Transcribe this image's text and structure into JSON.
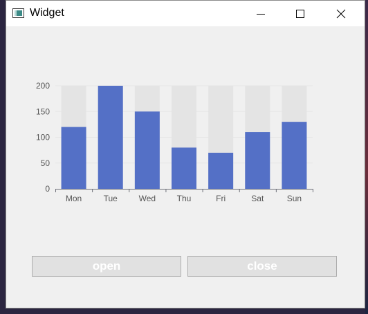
{
  "window": {
    "title": "Widget"
  },
  "buttons": {
    "open_label": "open",
    "close_label": "close"
  },
  "icons": {
    "app": "app-window-icon",
    "minimize": "minimize-icon",
    "maximize": "maximize-icon",
    "close": "close-icon"
  },
  "colors": {
    "bar": "#5470c6",
    "bar_background": "#e4e4e4",
    "window_bg": "#f0f0f0"
  },
  "chart_data": {
    "type": "bar",
    "categories": [
      "Mon",
      "Tue",
      "Wed",
      "Thu",
      "Fri",
      "Sat",
      "Sun"
    ],
    "values": [
      120,
      200,
      150,
      80,
      70,
      110,
      130
    ],
    "ylim": [
      0,
      200
    ],
    "yticks": [
      0,
      50,
      100,
      150,
      200
    ],
    "show_background": true,
    "grid": true
  }
}
